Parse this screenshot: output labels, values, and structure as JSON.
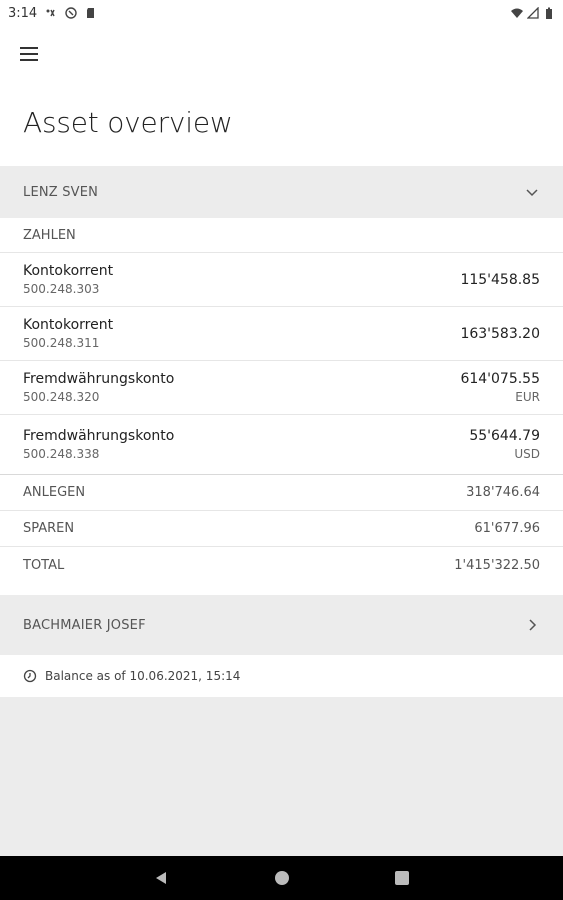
{
  "status_bar": {
    "time": "3:14"
  },
  "header": {
    "title": "Asset overview"
  },
  "groups": [
    {
      "name": "LENZ SVEN",
      "expanded": true,
      "section_label": "ZAHLEN",
      "accounts": [
        {
          "name": "Kontokorrent",
          "number": "500.248.303",
          "amount": "115'458.85",
          "currency": ""
        },
        {
          "name": "Kontokorrent",
          "number": "500.248.311",
          "amount": "163'583.20",
          "currency": ""
        },
        {
          "name": "Fremdwährungskonto",
          "number": "500.248.320",
          "amount": "614'075.55",
          "currency": "EUR"
        },
        {
          "name": "Fremdwährungskonto",
          "number": "500.248.338",
          "amount": "55'644.79",
          "currency": "USD"
        }
      ],
      "summary": [
        {
          "label": "ANLEGEN",
          "value": "318'746.64"
        },
        {
          "label": "SPAREN",
          "value": "61'677.96"
        },
        {
          "label": "TOTAL",
          "value": "1'415'322.50"
        }
      ]
    },
    {
      "name": "BACHMAIER JOSEF",
      "expanded": false
    }
  ],
  "balance_info": "Balance as of 10.06.2021, 15:14",
  "icons": {
    "menu": "menu-icon",
    "chevron_down": "chevron-down-icon",
    "chevron_right": "chevron-right-icon",
    "clock": "clock-icon"
  }
}
